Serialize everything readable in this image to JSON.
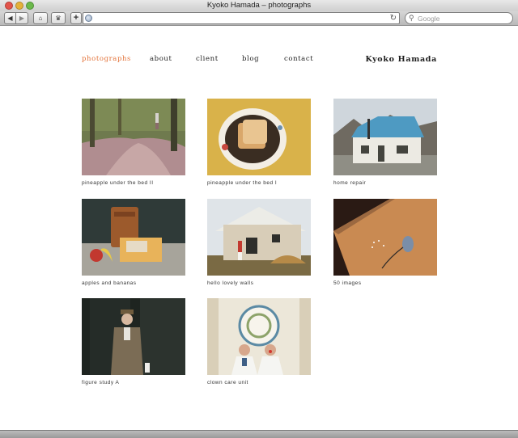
{
  "window": {
    "title": "Kyoko Hamada – photographs"
  },
  "toolbar": {
    "back_icon": "◀",
    "forward_icon": "▶",
    "home_icon": "⌂",
    "bookmarks_icon": "♛",
    "add_icon": "+",
    "reload_icon": "↻",
    "search_icon": "⚲"
  },
  "search": {
    "placeholder": "Google"
  },
  "nav": {
    "items": [
      {
        "label": "photographs",
        "active": true
      },
      {
        "label": "about"
      },
      {
        "label": "client"
      },
      {
        "label": "blog"
      },
      {
        "label": "contact"
      }
    ]
  },
  "site_title": "Kyoko Hamada",
  "gallery": {
    "items": [
      {
        "caption": "pineapple under the bed II"
      },
      {
        "caption": "pineapple under the bed I"
      },
      {
        "caption": "home repair"
      },
      {
        "caption": "apples and bananas"
      },
      {
        "caption": "hello lovely walls"
      },
      {
        "caption": "50 images"
      },
      {
        "caption": "figure study A"
      },
      {
        "caption": "clown care unit"
      }
    ]
  },
  "colors": {
    "accent": "#e3733a",
    "text": "#222222"
  }
}
